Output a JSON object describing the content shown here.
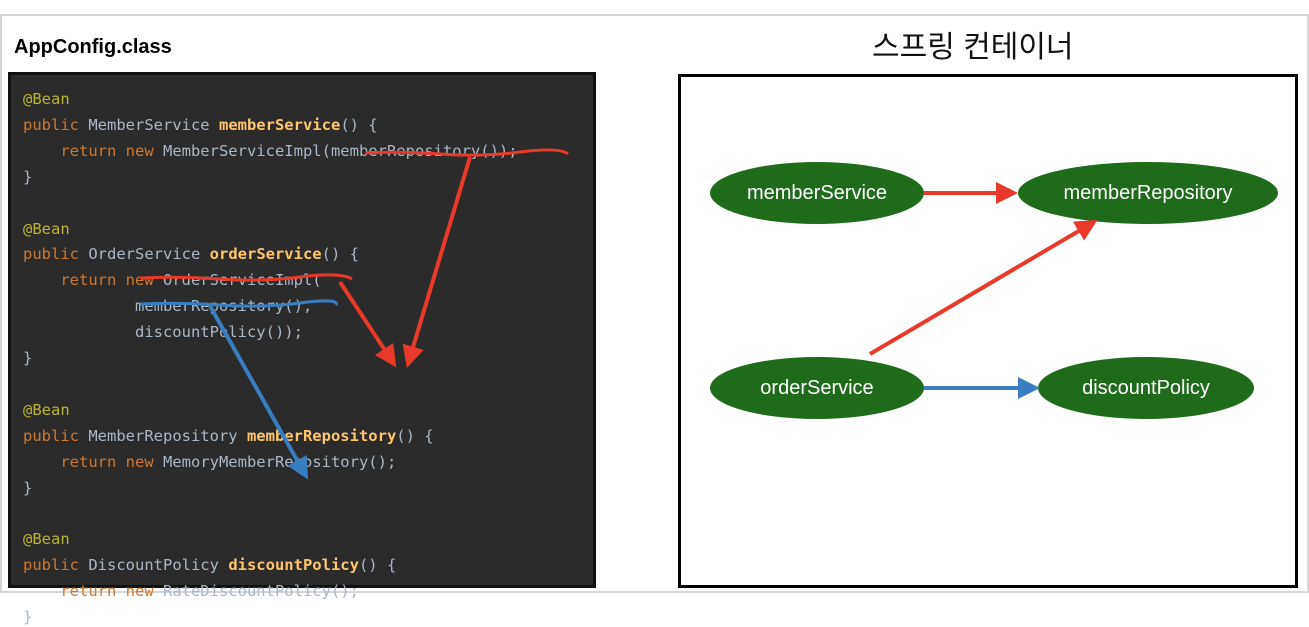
{
  "code": {
    "title": "AppConfig.class",
    "lines": [
      [
        {
          "t": "@Bean",
          "c": "an"
        }
      ],
      [
        {
          "t": "public ",
          "c": "kw"
        },
        {
          "t": "MemberService ",
          "c": ""
        },
        {
          "t": "memberService",
          "c": "fn"
        },
        {
          "t": "() {",
          "c": ""
        }
      ],
      [
        {
          "t": "    return new ",
          "c": "kw"
        },
        {
          "t": "MemberServiceImpl(memberRepository());",
          "c": ""
        }
      ],
      [
        {
          "t": "}",
          "c": ""
        }
      ],
      [
        {
          "t": "",
          "c": ""
        }
      ],
      [
        {
          "t": "@Bean",
          "c": "an"
        }
      ],
      [
        {
          "t": "public ",
          "c": "kw"
        },
        {
          "t": "OrderService ",
          "c": ""
        },
        {
          "t": "orderService",
          "c": "fn"
        },
        {
          "t": "() {",
          "c": ""
        }
      ],
      [
        {
          "t": "    return new ",
          "c": "kw"
        },
        {
          "t": "OrderServiceImpl(",
          "c": ""
        }
      ],
      [
        {
          "t": "            memberRepository(),",
          "c": ""
        }
      ],
      [
        {
          "t": "            discountPolicy());",
          "c": ""
        }
      ],
      [
        {
          "t": "}",
          "c": ""
        }
      ],
      [
        {
          "t": "",
          "c": ""
        }
      ],
      [
        {
          "t": "@Bean",
          "c": "an"
        }
      ],
      [
        {
          "t": "public ",
          "c": "kw"
        },
        {
          "t": "MemberRepository ",
          "c": ""
        },
        {
          "t": "memberRepository",
          "c": "fn"
        },
        {
          "t": "() {",
          "c": ""
        }
      ],
      [
        {
          "t": "    return new ",
          "c": "kw"
        },
        {
          "t": "MemoryMemberRepository();",
          "c": ""
        }
      ],
      [
        {
          "t": "}",
          "c": ""
        }
      ],
      [
        {
          "t": "",
          "c": ""
        }
      ],
      [
        {
          "t": "@Bean",
          "c": "an"
        }
      ],
      [
        {
          "t": "public ",
          "c": "kw"
        },
        {
          "t": "DiscountPolicy ",
          "c": ""
        },
        {
          "t": "discountPolicy",
          "c": "fn"
        },
        {
          "t": "() {",
          "c": ""
        }
      ],
      [
        {
          "t": "    return new ",
          "c": "kw"
        },
        {
          "t": "RateDiscountPolicy();",
          "c": ""
        }
      ],
      [
        {
          "t": "}",
          "c": ""
        }
      ]
    ]
  },
  "container": {
    "title": "스프링 컨테이너",
    "nodes": {
      "memberService": "memberService",
      "memberRepository": "memberRepository",
      "orderService": "orderService",
      "discountPolicy": "discountPolicy"
    }
  },
  "colors": {
    "node": "#1e6b1a",
    "red_arrow": "#e8392a",
    "blue_arrow": "#3a7ec2"
  }
}
